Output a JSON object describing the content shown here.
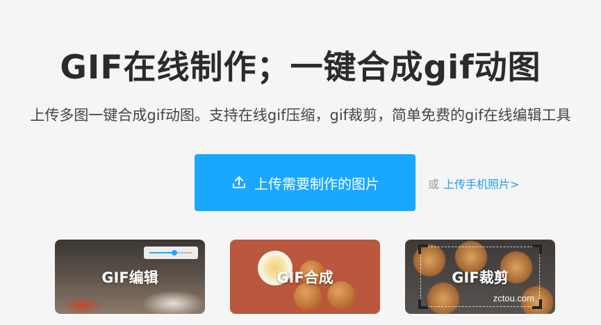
{
  "header": {
    "title": "GIF在线制作；一键合成gif动图",
    "subtitle": "上传多图一键合成gif动图。支持在线gif压缩，gif裁剪，简单免费的gif在线编辑工具"
  },
  "upload": {
    "button_label": "上传需要制作的图片",
    "or_text": "或",
    "mobile_link": "上传手机照片>",
    "accent_color": "#1aa7ff"
  },
  "cards": [
    {
      "label": "GIF编辑",
      "icon": "slider-icon"
    },
    {
      "label": "GIF合成"
    },
    {
      "label": "GIF裁剪",
      "icon": "crop-frame-icon"
    }
  ],
  "watermark": "zctou.com"
}
